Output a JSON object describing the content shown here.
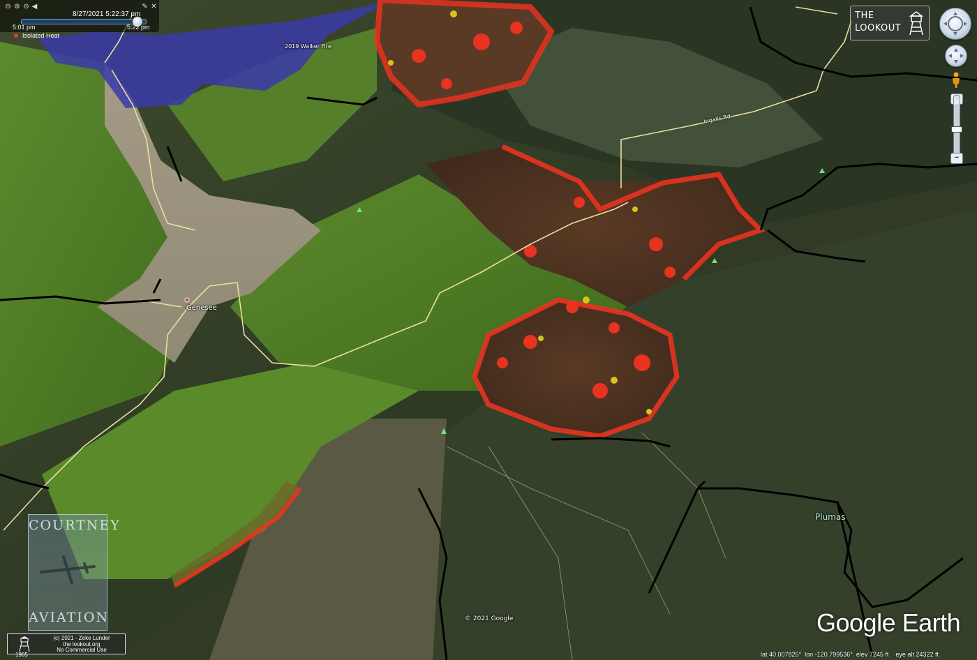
{
  "time_slider": {
    "date_time": "8/27/2021  5:22:37 pm",
    "start_label": "5:01 pm",
    "end_label": "5:22 pm",
    "position": 0.93
  },
  "legend": {
    "isolated_heat_label": "Isolated Heat",
    "isolated_heat_color": "#e23a2c"
  },
  "map_labels": {
    "walker_fire": "2019 Walker Fire",
    "genesee": "Genesee",
    "plumas": "Plumas",
    "road_name": "Ingalls Rd",
    "google_copyright": "© 2021 Google"
  },
  "logo": {
    "line1": "THE",
    "line2": "LOOKOUT"
  },
  "aviation_badge": {
    "top_word": "COURTNEY",
    "bottom_word": "AVIATION"
  },
  "copyright": {
    "line1": "(c) 2021 - Zeke Lunder",
    "line2": "the lookout.org",
    "line3": "No Commercial Use",
    "year_label": "1985"
  },
  "status_bar": {
    "lat": "lat  40.007825°",
    "lon": "lon -120.799536°",
    "elev": "elev  7245 ft",
    "eye_alt": "eye alt  24322 ft"
  },
  "brand": "Google Earth",
  "colors": {
    "fire_perimeter_old": "#3a3aa8",
    "heat_red": "#e83320",
    "heat_yellow": "#d9c21e",
    "road": "#e8e0a0",
    "boundary": "#000000"
  }
}
